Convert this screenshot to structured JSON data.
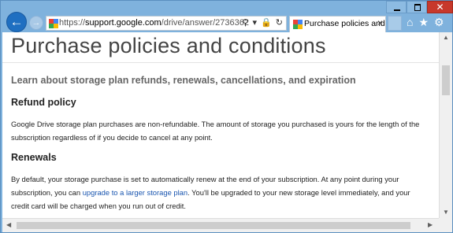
{
  "browser": {
    "url_prefix": "https://",
    "url_host": "support.google.com",
    "url_path": "/drive/answer/2736362",
    "tab_title": "Purchase policies and ...",
    "tab_close": "×",
    "close_glyph": "✕",
    "back_glyph": "←",
    "forward_glyph": "→",
    "address_icons": [
      "search-icon",
      "lock-icon",
      "refresh-icon"
    ],
    "toolbar_icons": [
      "home-icon",
      "favorites-icon",
      "settings-icon"
    ]
  },
  "page": {
    "title": "Purchase policies and conditions",
    "subtitle": "Learn about storage plan refunds, renewals, cancellations, and expiration",
    "refund": {
      "heading": "Refund policy",
      "text": "Google Drive storage plan purchases are non-refundable. The amount of storage you purchased is yours for the length of the subscription regardless of if you decide to cancel at any point."
    },
    "renewals": {
      "heading": "Renewals",
      "text_before": "By default, your storage purchase is set to automatically renew at the end of your subscription. At any point during your subscription, you can ",
      "link": "upgrade to a larger storage plan",
      "text_after": ". You'll be upgraded to your new storage level immediately, and your credit card will be charged when you run out of credit."
    }
  },
  "colors": {
    "accent": "#1f6fc1",
    "link": "#1a56b0",
    "frame": "#7fb2dd"
  }
}
